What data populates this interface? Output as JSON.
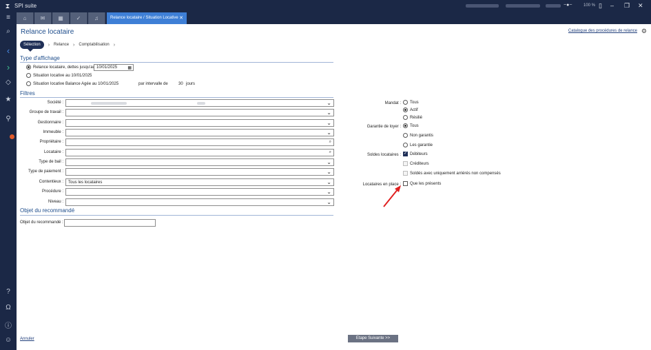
{
  "app": {
    "title": "SPI suite",
    "zoom": "100 %"
  },
  "tabs": [
    {
      "label": "Relance locataire / Situation Locative"
    }
  ],
  "page": {
    "title": "Relance locataire",
    "catalog_link": "Catalogue des procédures de relance"
  },
  "steps": {
    "active": "Sélection",
    "items": [
      "Relance",
      "Comptabilisation"
    ]
  },
  "type_affichage": {
    "title": "Type d'affichage",
    "opt1_label": "Relance locataire, dettes jusqu'au",
    "opt1_date": "10/01/2025",
    "opt2_label": "Situation locative au 10/01/2025",
    "opt3_label": "Situation locative Balance Agée au 10/01/2025",
    "interval_label": "par intervalle de",
    "interval_value": "30",
    "interval_unit": "jours"
  },
  "filtres": {
    "title": "Filtres",
    "fields": [
      {
        "label": "Société :",
        "value": ""
      },
      {
        "label": "Groupe de travail :",
        "value": ""
      },
      {
        "label": "Gestionnaire :",
        "value": ""
      },
      {
        "label": "Immeuble :",
        "value": ""
      },
      {
        "label": "Propriétaire :",
        "value": ""
      },
      {
        "label": "Locataire :",
        "value": ""
      },
      {
        "label": "Type de bail :",
        "value": ""
      },
      {
        "label": "Type de paiement :",
        "value": ""
      },
      {
        "label": "Contentieux :",
        "value": "Tous les locataires"
      },
      {
        "label": "Procédure :",
        "value": ""
      },
      {
        "label": "Niveau :",
        "value": ""
      }
    ],
    "mandat": {
      "label": "Mandat :",
      "options": [
        "Tous",
        "Actif",
        "Résilié"
      ]
    },
    "garantie": {
      "label": "Garantie de loyer :",
      "options": [
        "Tous",
        "Non garantis",
        "Les garantie"
      ]
    },
    "soldes": {
      "label": "Soldes locataires :",
      "options": [
        "Débiteurs",
        "Créditeurs",
        "Soldés avec uniquement arriérés non compensés"
      ]
    },
    "locataires_en_place": {
      "label": "Locataires en place :",
      "option": "Que les présents"
    }
  },
  "objet": {
    "title": "Objet du recommandé",
    "label": "Objet du recommandé :",
    "value": ""
  },
  "footer": {
    "cancel": "Annuler",
    "next": "Etape Suivante >>"
  },
  "colors": {
    "sidebar": "#1b2846",
    "accent_tab": "#3e7fd6",
    "title": "#1f4e8c",
    "arrow": "#e02020"
  }
}
